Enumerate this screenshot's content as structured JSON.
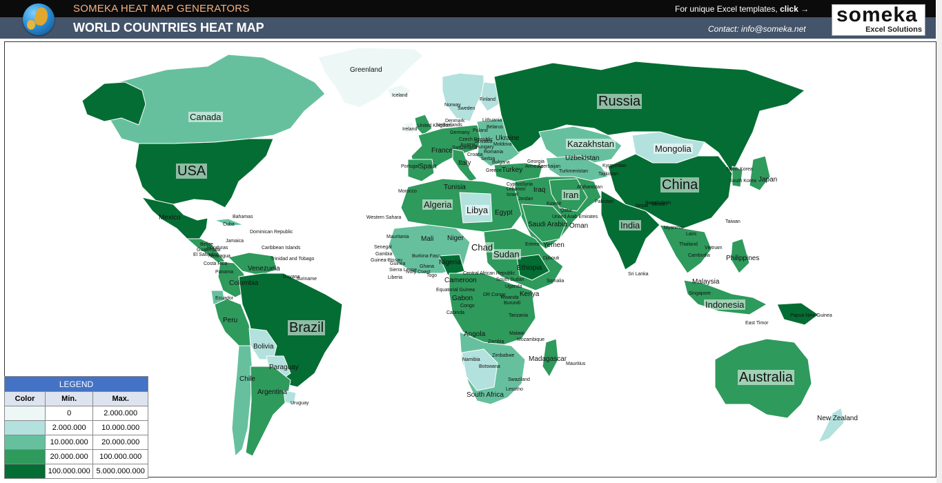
{
  "header": {
    "app_name": "SOMEKA HEAT MAP GENERATORS",
    "title": "WORLD COUNTRIES HEAT MAP",
    "templates_text": "For unique Excel templates, ",
    "templates_click": "click →",
    "contact": "Contact: info@someka.net",
    "logo_word": "someka",
    "logo_sub": "Excel Solutions"
  },
  "colors": {
    "level_1": "#edf8f6",
    "level_2": "#b3e1dd",
    "level_3": "#66c09e",
    "level_4": "#2e9a5c",
    "level_5": "#046d33",
    "ocean": "#ffffff",
    "header_top": "#0b0b0b",
    "header_bottom": "#44546a",
    "legend_head": "#4472c4"
  },
  "legend": {
    "title": "LEGEND",
    "col_color": "Color",
    "col_min": "Min.",
    "col_max": "Max.",
    "rows": [
      {
        "min": "0",
        "max": "2.000.000"
      },
      {
        "min": "2.000.000",
        "max": "10.000.000"
      },
      {
        "min": "10.000.000",
        "max": "20.000.000"
      },
      {
        "min": "20.000.000",
        "max": "100.000.000"
      },
      {
        "min": "100.000.000",
        "max": "5.000.000.000"
      }
    ]
  },
  "map": {
    "labels": {
      "greenland": "Greenland",
      "iceland": "Iceland",
      "canada": "Canada",
      "usa": "USA",
      "mexico": "Mexico",
      "cuba": "Cuba",
      "bahamas": "Bahamas",
      "jamaica": "Jamaica",
      "dominican_republic": "Dominican Republic",
      "caribbean": "Caribbean Islands",
      "belize": "Belize",
      "guatemala": "Guatemala",
      "honduras": "Honduras",
      "el_salvador": "El Salvador",
      "nicaragua": "Nicaragua",
      "costa_rica": "Costa Rica",
      "panama": "Panama",
      "trinidad": "Trinidad and Tobago",
      "venezuela": "Venezuela",
      "guyana": "Guyana",
      "suriname": "Suriname",
      "colombia": "Colombia",
      "ecuador": "Ecuador",
      "peru": "Peru",
      "brazil": "Brazil",
      "bolivia": "Bolivia",
      "paraguay": "Paraguay",
      "chile": "Chile",
      "argentina": "Argentina",
      "uruguay": "Uruguay",
      "norway": "Norway",
      "sweden": "Sweden",
      "finland": "Finland",
      "denmark": "Denmark",
      "uk": "United Kingdom",
      "ireland": "Ireland",
      "netherlands": "Netherlands",
      "germany": "Germany",
      "poland": "Poland",
      "belarus": "Belarus",
      "lithuania": "Lithuania",
      "czech": "Czech Republic",
      "slovakia": "Slovakia",
      "austria": "Austria",
      "hungary": "Hungary",
      "romania": "Romania",
      "moldova": "Moldova",
      "ukraine": "Ukraine",
      "france": "France",
      "spain": "Spain",
      "portugal": "Portugal",
      "italy": "Italy",
      "switzerland": "Switzerland",
      "croatia": "Croatia",
      "serbia": "Serbia",
      "bulgaria": "Bulgaria",
      "greece": "Greece",
      "turkey": "Turkey",
      "russia": "Russia",
      "georgia": "Georgia",
      "armenia": "Armenia",
      "azerbaijan": "Azerbaijan",
      "kazakhstan": "Kazakhstan",
      "uzbekistan": "Uzbekistan",
      "turkmenistan": "Turkmenistan",
      "kyrgyzstan": "Kyrgyzstan",
      "tajikistan": "Tajikistan",
      "mongolia": "Mongolia",
      "china": "China",
      "north_korea": "North Korea",
      "south_korea": "South Korea",
      "japan": "Japan",
      "taiwan": "Taiwan",
      "syria": "Syria",
      "cyprus": "Cyprus",
      "lebanon": "Lebanon",
      "israel": "Israel",
      "jordan": "Jordan",
      "iraq": "Iraq",
      "iran": "Iran",
      "afghanistan": "Afghanistan",
      "pakistan": "Pakistan",
      "kuwait": "Kuwait",
      "qatar": "Qatar",
      "uae": "United Arab Emirates",
      "saudi_arabia": "Saudi Arabia",
      "oman": "Oman",
      "yemen": "Yemen",
      "india": "India",
      "nepal": "Nepal",
      "bhutan": "Bhutan",
      "bangladesh": "Bangladesh",
      "sri_lanka": "Sri Lanka",
      "myanmar": "Myanmar",
      "laos": "Laos",
      "thailand": "Thailand",
      "vietnam": "Vietnam",
      "cambodia": "Cambodia",
      "philippines": "Philippines",
      "malaysia": "Malaysia",
      "singapore": "Singapore",
      "indonesia": "Indonesia",
      "east_timor": "East Timor",
      "png": "Papua New Guinea",
      "australia": "Australia",
      "new_zealand": "New Zealand",
      "morocco": "Morocco",
      "tunisia": "Tunisia",
      "algeria": "Algeria",
      "libya": "Libya",
      "egypt": "Egypt",
      "western_sahara": "Western Sahara",
      "mauritania": "Mauritania",
      "mali": "Mali",
      "niger": "Niger",
      "chad": "Chad",
      "sudan": "Sudan",
      "eritrea": "Eritrea",
      "djibouti": "Djibouti",
      "ethiopia": "Ethiopia",
      "somalia": "Somalia",
      "senegal": "Senegal",
      "gambia": "Gambia",
      "guinea_bissau": "Guinea-Bissau",
      "guinea": "Guinea",
      "sierra_leone": "Sierra Leone",
      "liberia": "Liberia",
      "ivory_coast": "Ivory Coast",
      "burkina_faso": "Burkina Faso",
      "ghana": "Ghana",
      "togo": "Togo",
      "nigeria": "Nigeria",
      "cameroon": "Cameroon",
      "car": "Central African Republic",
      "south_sudan": "South Sudan",
      "equatorial_guinea": "Equatorial Guinea",
      "gabon": "Gabon",
      "congo": "Congo",
      "dr_congo": "DR Congo",
      "uganda": "Uganda",
      "kenya": "Kenya",
      "rwanda": "Rwanda",
      "burundi": "Burundi",
      "tanzania": "Tanzania",
      "cabinda": "Cabinda",
      "angola": "Angola",
      "zambia": "Zambia",
      "malawi": "Malawi",
      "mozambique": "Mozambique",
      "zimbabwe": "Zimbabwe",
      "namibia": "Namibia",
      "botswana": "Botswana",
      "madagascar": "Madagascar",
      "mauritius": "Mauritius",
      "swaziland": "Swaziland",
      "lesotho": "Lesotho",
      "south_africa": "South Africa"
    }
  }
}
